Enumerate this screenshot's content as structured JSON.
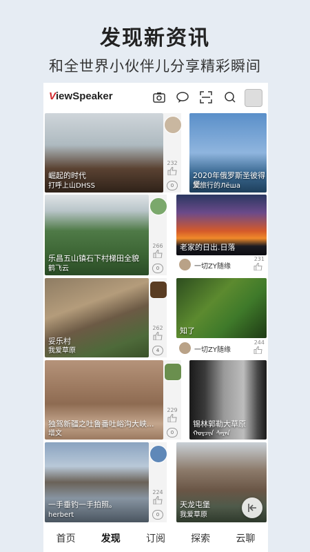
{
  "hero": {
    "title": "发现新资讯",
    "subtitle": "和全世界小伙伴儿分享精彩瞬间"
  },
  "app": {
    "logo_v": "V",
    "logo_rest": "iewSpeaker"
  },
  "cards": [
    {
      "title": "崛起的时代",
      "author": "打呼上山DHSS",
      "likes": "232",
      "comments": "0"
    },
    {
      "title": "2020年俄罗斯圣彼得堡",
      "author": "爱旅行的Лёша"
    },
    {
      "title": "乐昌五山镇石下村梯田全貌",
      "author": "鹤飞云",
      "likes": "266",
      "comments": "0"
    },
    {
      "title": "老家的日出.日落",
      "author": "一切ZY随缘",
      "likes": "231"
    },
    {
      "title": "妥乐村",
      "author": "我爱草原",
      "likes": "262",
      "comments": "4"
    },
    {
      "title": "知了",
      "author": "一切ZY随缘",
      "likes": "244"
    },
    {
      "title": "独驾新疆之吐鲁番吐峪沟大峡...",
      "author": "增文",
      "likes": "229",
      "comments": "0"
    },
    {
      "title": "锡林郭勒大草原",
      "author": "ᠬᠣᠷᠴᠢᠨ ᠰᠠᠷᠠᠨ"
    },
    {
      "title": "一手垂钓一手拍照。",
      "author": "herbert",
      "likes": "224",
      "comments": "0"
    },
    {
      "title": "天龙屯堡",
      "author": "我爱草原"
    }
  ],
  "nav": [
    "首页",
    "发现",
    "订阅",
    "探索",
    "云聊"
  ]
}
